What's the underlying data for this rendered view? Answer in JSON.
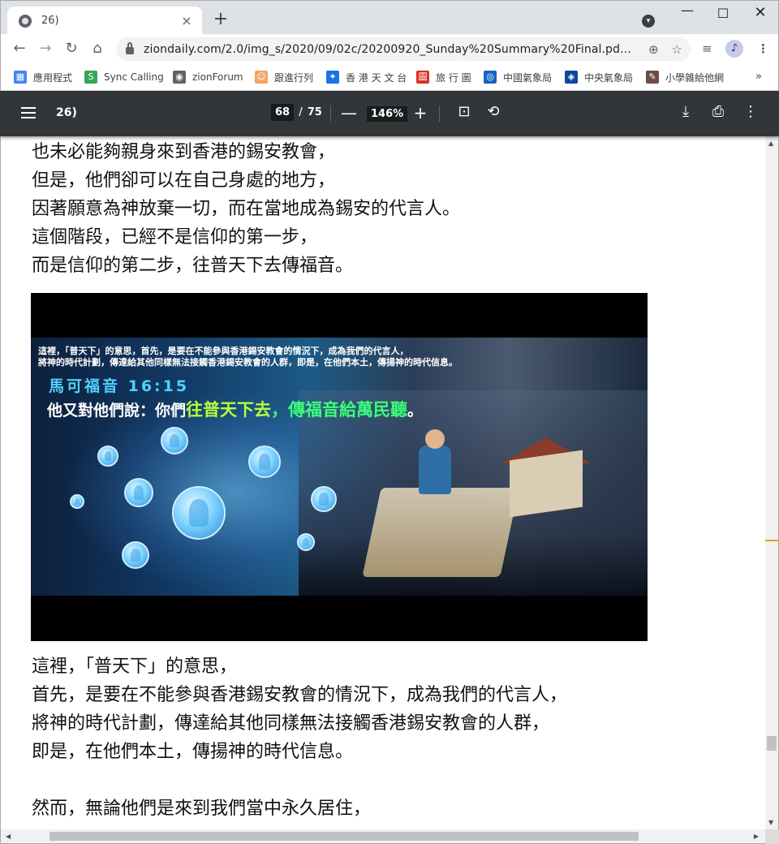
{
  "browser": {
    "tab_title": "26)",
    "tab_close": "×",
    "new_tab": "+",
    "url": "ziondaily.com/2.0/img_s/2020/09/02c/20200920_Sunday%20Summary%20Final.pdf?1600...",
    "window_controls": {
      "minimize": "—",
      "maximize": "☐",
      "close": "✕"
    }
  },
  "bookmarks": [
    {
      "label": "應用程式",
      "icon": "apps-grid-icon",
      "color": "#4285f4"
    },
    {
      "label": "Sync Calling",
      "icon": "sync-calling-icon",
      "color": "#34a853"
    },
    {
      "label": "zionForum",
      "icon": "zionforum-icon",
      "color": "#5f6368"
    },
    {
      "label": "跟進行列",
      "icon": "follow-up-icon",
      "color": "#f4a261"
    },
    {
      "label": "香 港 天 文 台",
      "icon": "hko-icon",
      "color": "#1a73e8"
    },
    {
      "label": "旅 行 圖",
      "icon": "travel-map-icon",
      "color": "#d93025"
    },
    {
      "label": "中國氣象局",
      "icon": "cma-icon",
      "color": "#1565c0"
    },
    {
      "label": "中央氣象局",
      "icon": "cwb-icon",
      "color": "#0d47a1"
    },
    {
      "label": "小學雜給他網",
      "icon": "school-icon",
      "color": "#6d4c41"
    }
  ],
  "bookmarks_more": "»",
  "pdf_toolbar": {
    "title": "26)",
    "current_page": "68",
    "page_separator": "/",
    "total_pages": "75",
    "zoom": "146%",
    "zoom_out": "—",
    "zoom_in": "+"
  },
  "document": {
    "lines_top": [
      "也未必能夠親身來到香港的錫安教會，",
      "但是，他們卻可以在自己身處的地方，",
      "因著願意為神放棄一切，而在當地成為錫安的代言人。",
      "這個階段，已經不是信仰的第一步，",
      "而是信仰的第二步，往普天下去傳福音。"
    ],
    "figure": {
      "note_line1": "這裡，「普天下」的意思，首先，是要在不能參與香港錫安教會的情況下，成為我們的代言人，",
      "note_line2": "將神的時代計劃，傳達給其他同樣無法接觸香港錫安教會的人群，即是，在他們本土，傳揚神的時代信息。",
      "reference": "馬可福音 16:15",
      "verse_prefix": "他又對他們說：你們",
      "verse_highlight1": "往普天下去",
      "verse_comma": "，",
      "verse_highlight2": "傳福音給萬民聽",
      "verse_end": "。"
    },
    "lines_bottom": [
      "這裡，「普天下」的意思，",
      "首先，是要在不能參與香港錫安教會的情況下，成為我們的代言人，",
      "將神的時代計劃，傳達給其他同樣無法接觸香港錫安教會的人群，",
      "即是，在他們本土，傳揚神的時代信息。",
      "",
      "然而，無論他們是來到我們當中永久居住，"
    ]
  }
}
